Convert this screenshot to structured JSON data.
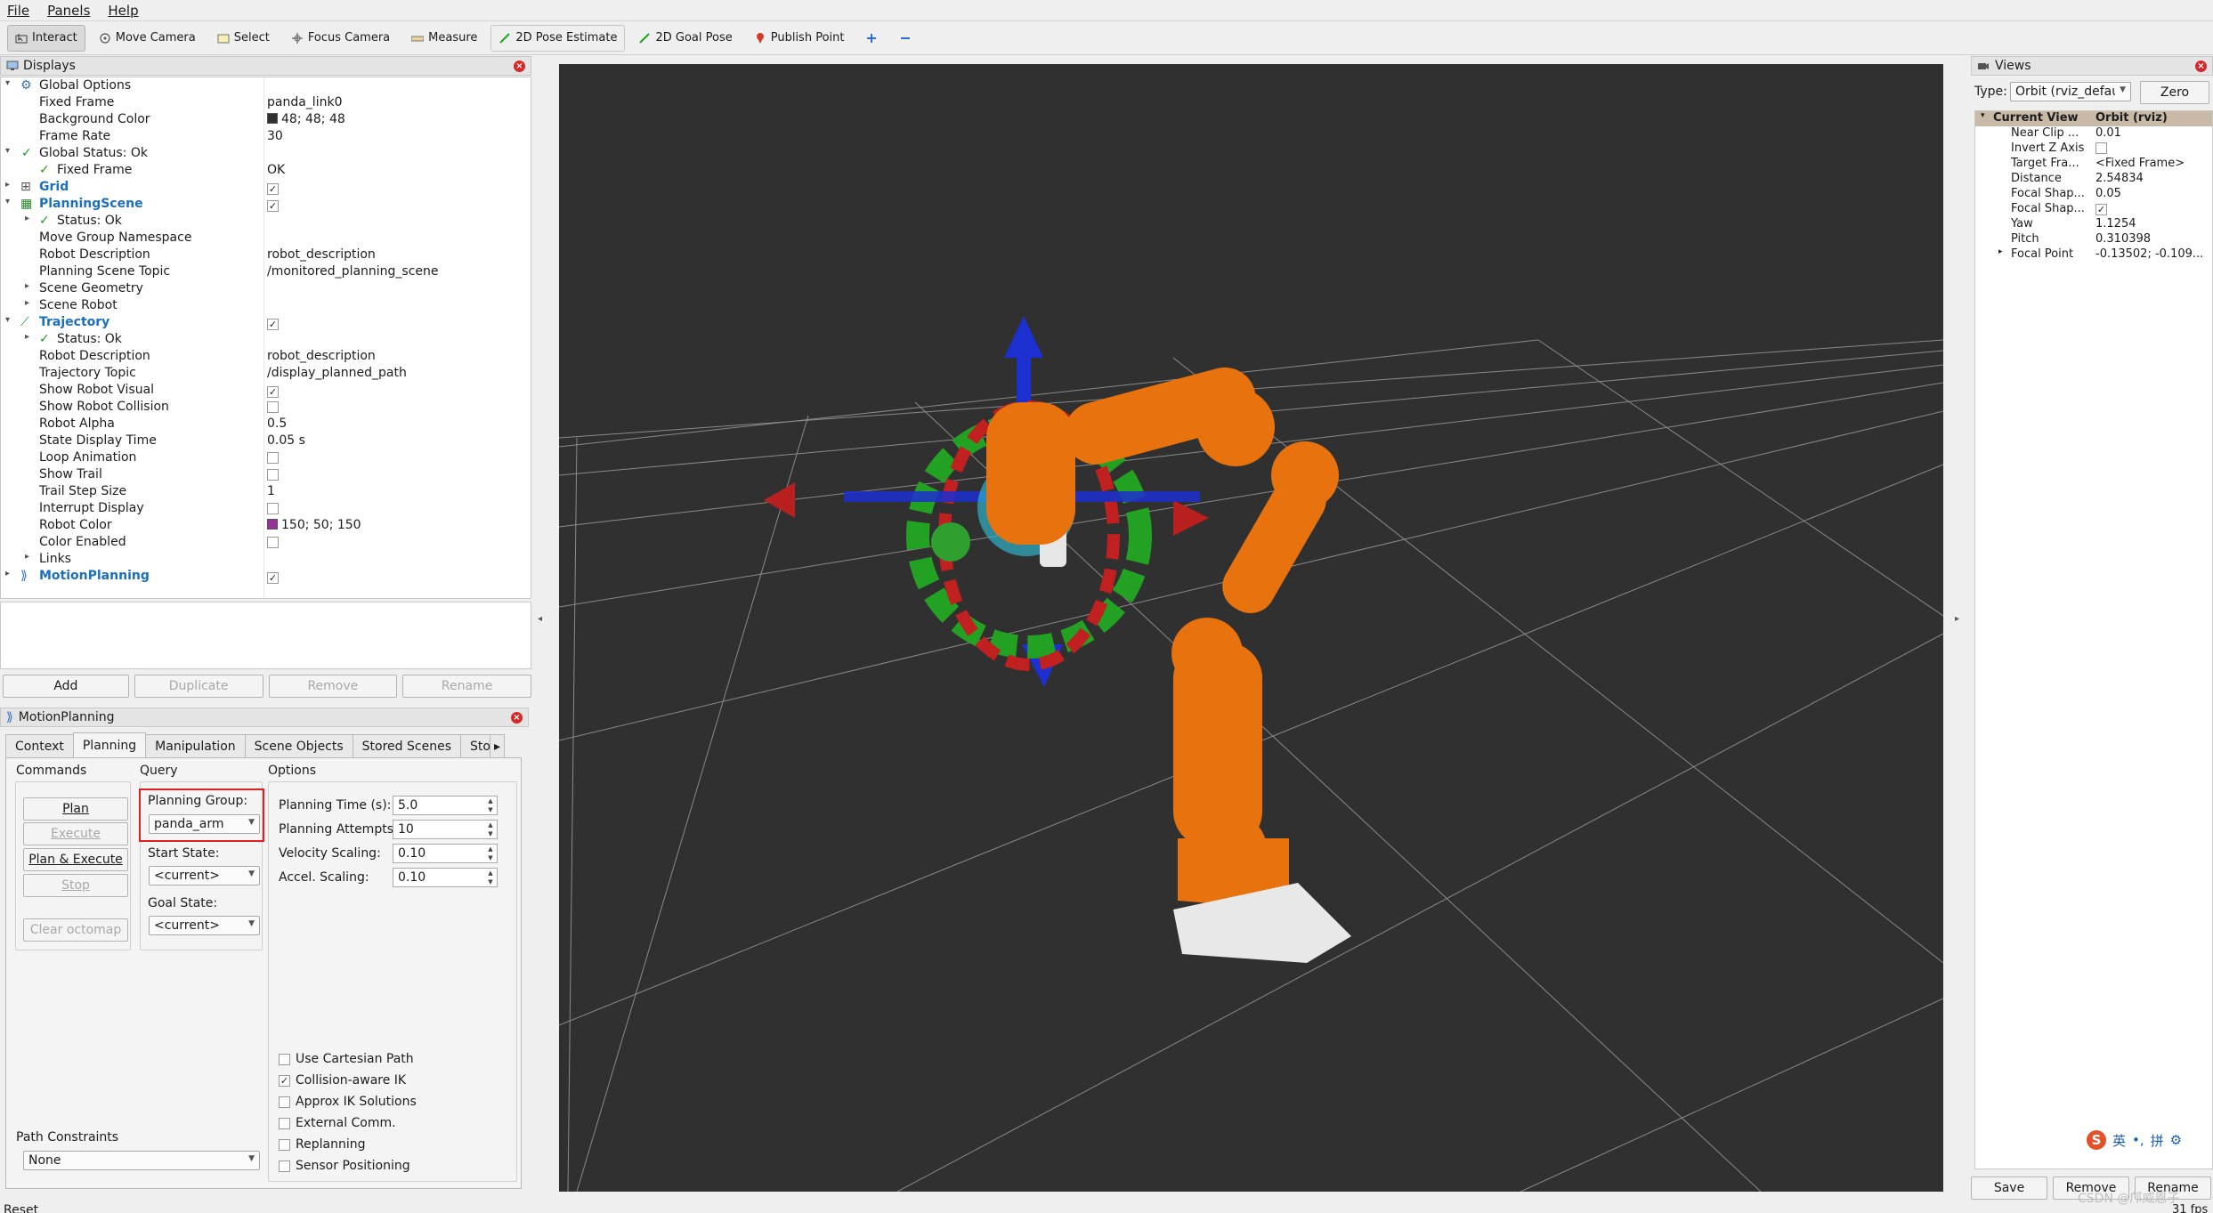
{
  "menu": {
    "file": "File",
    "panels": "Panels",
    "help": "Help"
  },
  "toolbar": {
    "interact": "Interact",
    "move_camera": "Move Camera",
    "select": "Select",
    "focus_camera": "Focus Camera",
    "measure": "Measure",
    "pose_estimate": "2D Pose Estimate",
    "goal_pose": "2D Goal Pose",
    "publish_point": "Publish Point"
  },
  "displays": {
    "title": "Displays",
    "rows": [
      {
        "name": "Global Options",
        "value": ""
      },
      {
        "name": "Fixed Frame",
        "value": "panda_link0"
      },
      {
        "name": "Background Color",
        "value": "48; 48; 48"
      },
      {
        "name": "Frame Rate",
        "value": "30"
      },
      {
        "name": "Global Status: Ok",
        "value": ""
      },
      {
        "name": "Fixed Frame",
        "value": "OK"
      },
      {
        "name": "Grid",
        "value": ""
      },
      {
        "name": "PlanningScene",
        "value": ""
      },
      {
        "name": "Status: Ok",
        "value": ""
      },
      {
        "name": "Move Group Namespace",
        "value": ""
      },
      {
        "name": "Robot Description",
        "value": "robot_description"
      },
      {
        "name": "Planning Scene Topic",
        "value": "/monitored_planning_scene"
      },
      {
        "name": "Scene Geometry",
        "value": ""
      },
      {
        "name": "Scene Robot",
        "value": ""
      },
      {
        "name": "Trajectory",
        "value": ""
      },
      {
        "name": "Status: Ok",
        "value": ""
      },
      {
        "name": "Robot Description",
        "value": "robot_description"
      },
      {
        "name": "Trajectory Topic",
        "value": "/display_planned_path"
      },
      {
        "name": "Show Robot Visual",
        "value": ""
      },
      {
        "name": "Show Robot Collision",
        "value": ""
      },
      {
        "name": "Robot Alpha",
        "value": "0.5"
      },
      {
        "name": "State Display Time",
        "value": "0.05 s"
      },
      {
        "name": "Loop Animation",
        "value": ""
      },
      {
        "name": "Show Trail",
        "value": ""
      },
      {
        "name": "Trail Step Size",
        "value": "1"
      },
      {
        "name": "Interrupt Display",
        "value": ""
      },
      {
        "name": "Robot Color",
        "value": "150; 50; 150"
      },
      {
        "name": "Color Enabled",
        "value": ""
      },
      {
        "name": "Links",
        "value": ""
      },
      {
        "name": "MotionPlanning",
        "value": ""
      }
    ],
    "buttons": {
      "add": "Add",
      "duplicate": "Duplicate",
      "remove": "Remove",
      "rename": "Rename"
    }
  },
  "colors": {
    "background": "#303030",
    "robot": "#9632 96",
    "bg_swatch": "#303030",
    "robot_swatch": "#963296"
  },
  "motion": {
    "title": "MotionPlanning",
    "tabs": [
      "Context",
      "Planning",
      "Manipulation",
      "Scene Objects",
      "Stored Scenes",
      "Sto"
    ],
    "commands_label": "Commands",
    "query_label": "Query",
    "options_label": "Options",
    "plan": "Plan",
    "execute": "Execute",
    "plan_execute": "Plan & Execute",
    "stop": "Stop",
    "clear_octomap": "Clear octomap",
    "planning_group_label": "Planning Group:",
    "planning_group": "panda_arm",
    "start_state_label": "Start State:",
    "start_state": "<current>",
    "goal_state_label": "Goal State:",
    "goal_state": "<current>",
    "planning_time_label": "Planning Time (s):",
    "planning_time": "5.0",
    "planning_attempts_label": "Planning Attempts:",
    "planning_attempts": "10",
    "velocity_label": "Velocity Scaling:",
    "velocity": "0.10",
    "accel_label": "Accel. Scaling:",
    "accel": "0.10",
    "checks": [
      {
        "label": "Use Cartesian Path",
        "checked": false
      },
      {
        "label": "Collision-aware IK",
        "checked": true
      },
      {
        "label": "Approx IK Solutions",
        "checked": false
      },
      {
        "label": "External Comm.",
        "checked": false
      },
      {
        "label": "Replanning",
        "checked": false
      },
      {
        "label": "Sensor Positioning",
        "checked": false
      }
    ],
    "path_constraints_label": "Path Constraints",
    "path_constraints": "None"
  },
  "views": {
    "title": "Views",
    "type_label": "Type:",
    "type_value": "Orbit (rviz_defau",
    "zero": "Zero",
    "current_view": "Current View",
    "current_view_value": "Orbit (rviz)",
    "rows": [
      {
        "name": "Near Clip ...",
        "value": "0.01"
      },
      {
        "name": "Invert Z Axis",
        "value": ""
      },
      {
        "name": "Target Fra...",
        "value": "<Fixed Frame>"
      },
      {
        "name": "Distance",
        "value": "2.54834"
      },
      {
        "name": "Focal Shap...",
        "value": "0.05"
      },
      {
        "name": "Focal Shap...",
        "value": ""
      },
      {
        "name": "Yaw",
        "value": "1.1254"
      },
      {
        "name": "Pitch",
        "value": "0.310398"
      },
      {
        "name": "Focal Point",
        "value": "-0.13502; -0.109..."
      }
    ],
    "save": "Save",
    "remove": "Remove",
    "rename": "Rename"
  },
  "status": {
    "reset": "Reset",
    "fps": "31 fps",
    "watermark": "CSDN @邝威恩子",
    "ime": "英"
  }
}
